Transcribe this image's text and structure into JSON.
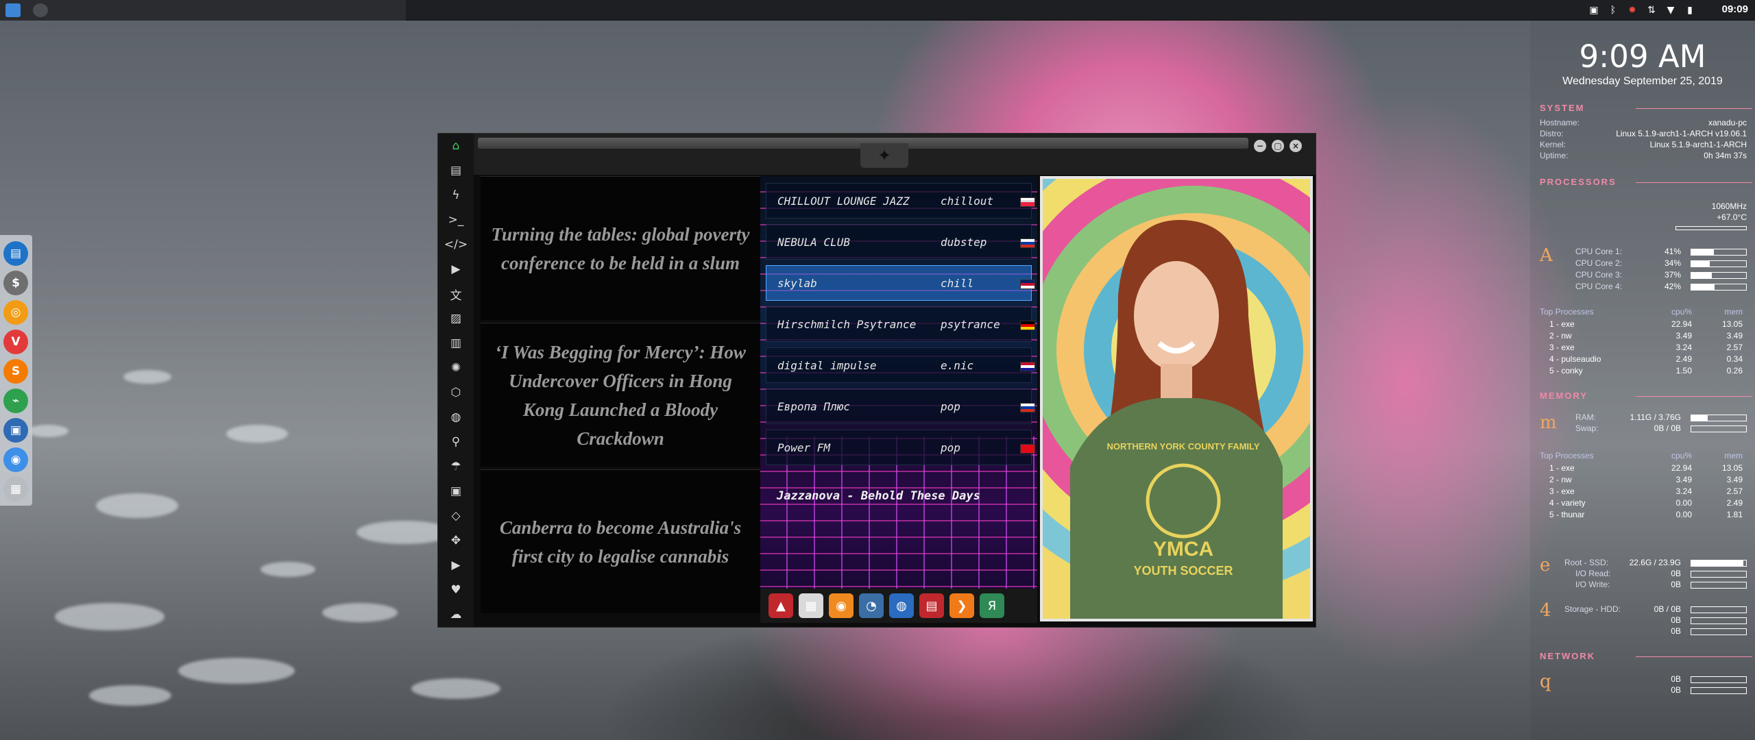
{
  "taskbar": {
    "clock": "09:09",
    "launcher_icons": [
      "file-manager-icon",
      "workspace-icon"
    ],
    "tray_icons": [
      "screenshot-icon",
      "bluetooth-icon",
      "update-icon",
      "network-icon",
      "wifi-icon",
      "battery-icon"
    ]
  },
  "left_dock": {
    "items": [
      {
        "name": "file-manager-icon",
        "glyph": "▤",
        "color": "#1e73c8"
      },
      {
        "name": "terminal-dollar-icon",
        "glyph": "$",
        "color": "#6f6f6f"
      },
      {
        "name": "ubuntu-icon",
        "glyph": "◎",
        "color": "#f29b14"
      },
      {
        "name": "vivaldi-icon",
        "glyph": "V",
        "color": "#e23a3a"
      },
      {
        "name": "sublime-icon",
        "glyph": "S",
        "color": "#f57b00"
      },
      {
        "name": "system-monitor-icon",
        "glyph": "⌁",
        "color": "#2fa04e"
      },
      {
        "name": "screen-icon",
        "glyph": "▣",
        "color": "#2f6ab5"
      },
      {
        "name": "chrome-icon",
        "glyph": "◉",
        "color": "#3d8fe8"
      },
      {
        "name": "network-grid-icon",
        "glyph": "▦",
        "color": "#b8bcc0"
      }
    ]
  },
  "conky": {
    "time": "9:09 AM",
    "date": "Wednesday September 25, 2019",
    "system": {
      "title": "SYSTEM",
      "rows": [
        {
          "k": "Hostname:",
          "v": "xanadu-pc"
        },
        {
          "k": "Distro:",
          "v": "Linux 5.1.9-arch1-1-ARCH v19.06.1"
        },
        {
          "k": "Kernel:",
          "v": "Linux 5.1.9-arch1-1-ARCH"
        },
        {
          "k": "Uptime:",
          "v": "0h 34m 37s"
        }
      ]
    },
    "processors": {
      "title": "PROCESSORS",
      "freq": "1060MHz",
      "temp": "+67.0°C",
      "letter": "A",
      "cores": [
        {
          "k": "CPU Core 1:",
          "v": "41%",
          "level": 0.41
        },
        {
          "k": "CPU Core 2:",
          "v": "34%",
          "level": 0.34
        },
        {
          "k": "CPU Core 3:",
          "v": "37%",
          "level": 0.37
        },
        {
          "k": "CPU Core 4:",
          "v": "42%",
          "level": 0.42
        }
      ],
      "top_label": "Top Processes",
      "col_cpu": "cpu%",
      "col_mem": "mem",
      "procs": [
        {
          "n": "1 - exe",
          "c": "22.94",
          "m": "13.05"
        },
        {
          "n": "2 - nw",
          "c": "3.49",
          "m": "3.49"
        },
        {
          "n": "3 - exe",
          "c": "3.24",
          "m": "2.57"
        },
        {
          "n": "4 - pulseaudio",
          "c": "2.49",
          "m": "0.34"
        },
        {
          "n": "5 - conky",
          "c": "1.50",
          "m": "0.26"
        }
      ]
    },
    "memory": {
      "title": "MEMORY",
      "letter": "m",
      "ram_label": "RAM:",
      "ram": "1.11G / 3.76G",
      "ram_level": 0.3,
      "swap_label": "Swap:",
      "swap": "0B / 0B",
      "top_label": "Top Processes",
      "col_cpu": "cpu%",
      "col_mem": "mem",
      "procs": [
        {
          "n": "1 - exe",
          "c": "22.94",
          "m": "13.05"
        },
        {
          "n": "2 - nw",
          "c": "3.49",
          "m": "3.49"
        },
        {
          "n": "3 - exe",
          "c": "3.24",
          "m": "2.57"
        },
        {
          "n": "4 - variety",
          "c": "0.00",
          "m": "2.49"
        },
        {
          "n": "5 - thunar",
          "c": "0.00",
          "m": "1.81"
        }
      ]
    },
    "disk": {
      "letter": "e",
      "root_label": "Root - SSD:",
      "root": "22.6G / 23.9G",
      "root_level": 0.95,
      "io_read_label": "I/O Read:",
      "io_read": "0B",
      "io_write_label": "I/O Write:",
      "io_write": "0B",
      "letter2": "4",
      "hdd_label": "Storage - HDD:",
      "hdd": "0B / 0B",
      "hdd_r": "0B",
      "hdd_w": "0B"
    },
    "network": {
      "title": "NETWORK",
      "letter": "q",
      "down": "0B",
      "up": "0B"
    }
  },
  "window": {
    "logo_glyph": "✦",
    "controls": {
      "min": "−",
      "max": "▢",
      "close": "×"
    },
    "sidebar_icons": [
      {
        "name": "home-icon",
        "glyph": "⌂"
      },
      {
        "name": "document-icon",
        "glyph": "▤"
      },
      {
        "name": "lightning-icon",
        "glyph": "ϟ"
      },
      {
        "name": "terminal-icon",
        "glyph": ">_"
      },
      {
        "name": "code-icon",
        "glyph": "</>"
      },
      {
        "name": "play-icon",
        "glyph": "▶"
      },
      {
        "name": "translate-icon",
        "glyph": "文"
      },
      {
        "name": "image-icon",
        "glyph": "▨"
      },
      {
        "name": "news-icon",
        "glyph": "▥"
      },
      {
        "name": "aperture-icon",
        "glyph": "✺"
      },
      {
        "name": "hexagon-icon",
        "glyph": "⬡"
      },
      {
        "name": "globe-icon",
        "glyph": "◍"
      },
      {
        "name": "search-icon",
        "glyph": "⚲"
      },
      {
        "name": "umbrella-icon",
        "glyph": "☂"
      },
      {
        "name": "contacts-icon",
        "glyph": "▣"
      },
      {
        "name": "tags-icon",
        "glyph": "◇"
      },
      {
        "name": "expand-icon",
        "glyph": "✥"
      },
      {
        "name": "youtube-icon",
        "glyph": "▶"
      },
      {
        "name": "heart-icon",
        "glyph": "♥"
      },
      {
        "name": "cloud-icon",
        "glyph": "☁"
      }
    ],
    "news": [
      "Turning the tables: global poverty conference to be held in a slum",
      "‘I Was Begging for Mercy’: How Undercover Officers in Hong Kong Launched a Bloody Crackdown",
      "Canberra to become Australia's first city to legalise cannabis"
    ],
    "stations": [
      {
        "name": "CHILLOUT LOUNGE JAZZ",
        "genre": "chillout",
        "flag": [
          "#fff",
          "#ddd",
          "#e24",
          "#e24"
        ]
      },
      {
        "name": "NEBULA CLUB",
        "genre": "dubstep",
        "flag": [
          "#fff",
          "#0039a6",
          "#d52b1e"
        ]
      },
      {
        "name": "skylab",
        "genre": "chill",
        "flag": [
          "#012169",
          "#c8102e",
          "#fff"
        ],
        "selected": true
      },
      {
        "name": "Hirschmilch Psytrance",
        "genre": "psytrance",
        "flag": [
          "#000",
          "#dd0000",
          "#ffce00"
        ]
      },
      {
        "name": "digital impulse",
        "genre": "e.nic",
        "flag": [
          "#c8102e",
          "#fff",
          "#171796"
        ]
      },
      {
        "name": "Европа Плюс",
        "genre": "pop",
        "flag": [
          "#fff",
          "#0039a6",
          "#d52b1e"
        ]
      },
      {
        "name": "Power FM",
        "genre": "pop",
        "flag": [
          "#e30a17",
          "#e30a17",
          "#e30a17"
        ]
      }
    ],
    "now_playing": "Jazzanova - Behold These Days",
    "dock_icons": [
      {
        "name": "arch-icon",
        "glyph": "▲",
        "color": "#c0282d"
      },
      {
        "name": "calendar-icon",
        "glyph": "▦",
        "color": "#d9d9d9"
      },
      {
        "name": "search-app-icon",
        "glyph": "◉",
        "color": "#f08a20"
      },
      {
        "name": "clock-icon",
        "glyph": "◔",
        "color": "#3b6ea5"
      },
      {
        "name": "web-browser-icon",
        "glyph": "◍",
        "color": "#2a6cc0"
      },
      {
        "name": "planner-icon",
        "glyph": "▤",
        "color": "#c0282d"
      },
      {
        "name": "forward-icon",
        "glyph": "❯",
        "color": "#f07a1a"
      },
      {
        "name": "yandex-icon",
        "glyph": "Я",
        "color": "#2f8a55"
      }
    ],
    "photo": {
      "shirt_line1": "NORTHERN YORK COUNTY FAMILY",
      "shirt_line2": "YMCA",
      "shirt_line3": "YOUTH SOCCER"
    }
  }
}
